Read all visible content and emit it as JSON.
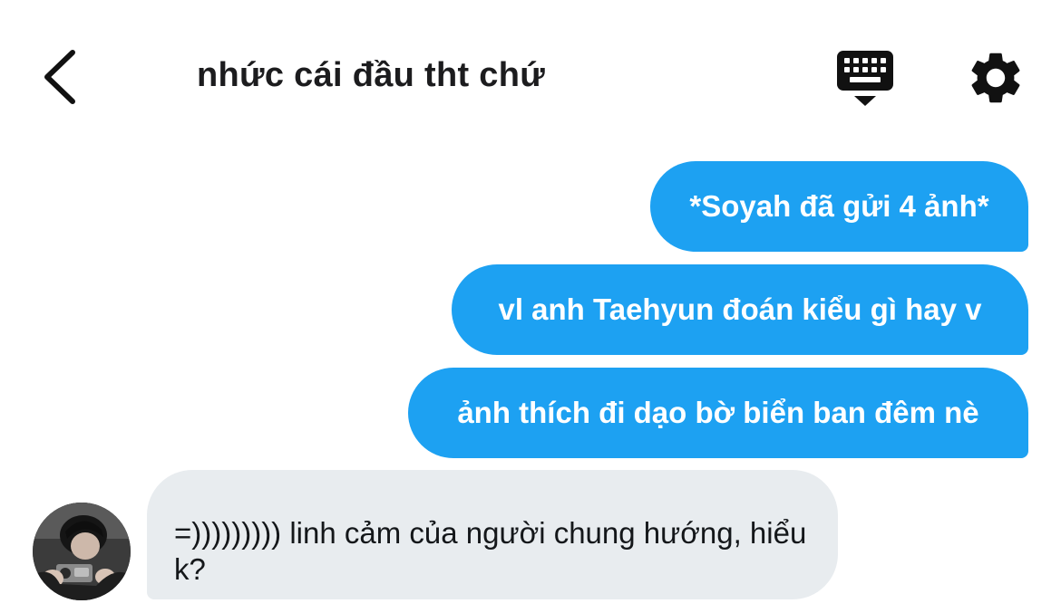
{
  "header": {
    "title": "nhức cái đầu tht chứ",
    "back_icon": "chevron-left-icon",
    "keyboard_icon": "keyboard-icon",
    "settings_icon": "gear-icon"
  },
  "messages": [
    {
      "direction": "outgoing",
      "text": "*Soyah đã gửi 4 ảnh*"
    },
    {
      "direction": "outgoing",
      "text": "vl anh Taehyun đoán kiểu gì hay v"
    },
    {
      "direction": "outgoing",
      "text": "ảnh thích đi dạo bờ biển ban đêm nè"
    },
    {
      "direction": "incoming",
      "text": "=))))))))) linh cảm của người chung hướng, hiểu k?"
    }
  ],
  "colors": {
    "outgoing_bubble": "#1da1f2",
    "incoming_bubble": "#e8ecef",
    "text_dark": "#14171a"
  }
}
